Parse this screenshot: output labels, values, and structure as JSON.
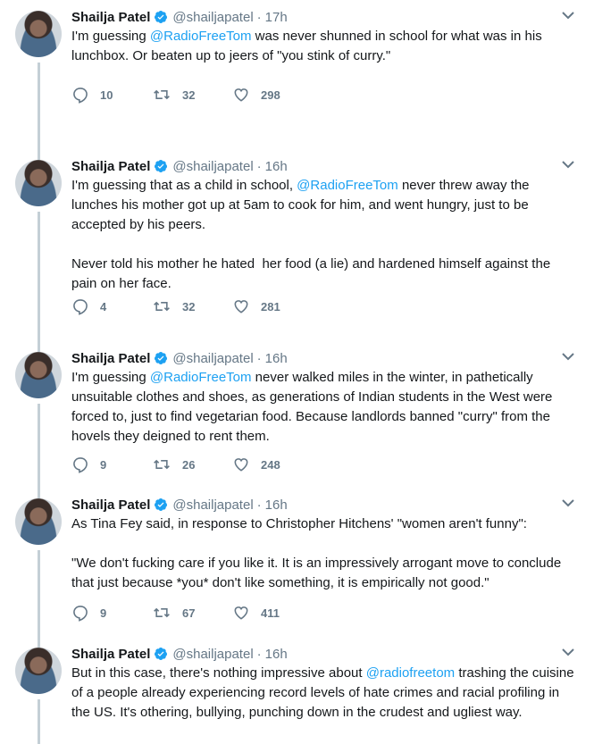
{
  "user": {
    "name": "Shailja Patel",
    "handle": "@shailjapatel"
  },
  "tweets": [
    {
      "time": "17h",
      "pre": "I'm guessing ",
      "mention": "@RadioFreeTom",
      "post": " was never shunned in school for what was in his lunchbox. Or beaten up to jeers of \"you stink of curry.\"",
      "replies": "10",
      "retweets": "32",
      "likes": "298"
    },
    {
      "time": "16h",
      "pre": "I'm guessing that as a child in school, ",
      "mention": "@RadioFreeTom",
      "post": " never threw away the lunches his mother got up at 5am to cook for him, and went hungry, just to be accepted by his peers.\n\nNever told his mother he hated  her food (a lie) and hardened himself against the pain on her face.",
      "replies": "4",
      "retweets": "32",
      "likes": "281"
    },
    {
      "time": "16h",
      "pre": "I'm guessing ",
      "mention": "@RadioFreeTom",
      "post": " never walked miles in the winter, in pathetically unsuitable clothes and shoes, as generations of Indian students in the West were forced to, just to find vegetarian food. Because landlords banned \"curry\" from the hovels they deigned to rent them.",
      "replies": "9",
      "retweets": "26",
      "likes": "248"
    },
    {
      "time": "16h",
      "pre": "As Tina Fey said, in response to Christopher Hitchens' \"women aren't funny\":\n\n\"We don't fucking care if you like it. It is an impressively arrogant move to conclude that just because *you* don't like something, it is empirically not good.\"",
      "mention": "",
      "post": "",
      "replies": "9",
      "retweets": "67",
      "likes": "411"
    },
    {
      "time": "16h",
      "pre": "But in this case, there's nothing impressive about ",
      "mention": "@radiofreetom",
      "post": " trashing the cuisine of a people already experiencing record levels of hate crimes and racial profiling in the US. It's othering, bullying, punching down in the crudest and ugliest way.",
      "replies": "",
      "retweets": "",
      "likes": ""
    }
  ],
  "colors": {
    "accent": "#1da1f2",
    "muted": "#657786",
    "rail": "#c4cfd6"
  },
  "icons": [
    "verified-icon",
    "caret-down-icon",
    "reply-icon",
    "retweet-icon",
    "like-icon"
  ]
}
